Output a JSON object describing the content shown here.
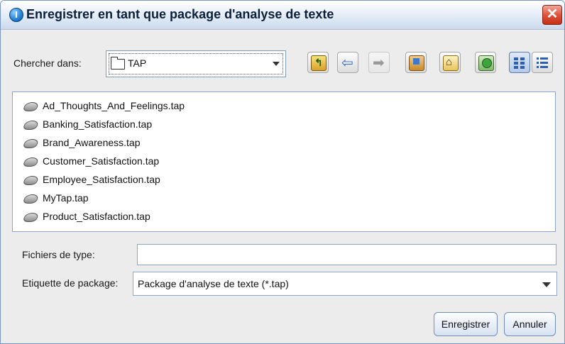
{
  "window": {
    "title": "Enregistrer en tant que package d'analyse de texte"
  },
  "look_in": {
    "label": "Chercher dans:",
    "value": "TAP"
  },
  "toolbar": {
    "icons": [
      "folder-up-icon",
      "back-icon",
      "forward-icon",
      "desktop-icon",
      "home-icon",
      "new-folder-icon",
      "list-view-icon",
      "details-view-icon"
    ]
  },
  "files": [
    "Ad_Thoughts_And_Feelings.tap",
    "Banking_Satisfaction.tap",
    "Brand_Awareness.tap",
    "Customer_Satisfaction.tap",
    "Employee_Satisfaction.tap",
    "MyTap.tap",
    "Product_Satisfaction.tap"
  ],
  "file_name": {
    "label": "Fichiers de type:",
    "value": ""
  },
  "file_type": {
    "label": "Etiquette de package:",
    "value": "Package d'analyse de texte (*.tap)"
  },
  "buttons": {
    "save": "Enregistrer",
    "cancel": "Annuler"
  },
  "colors": {
    "title_gradient_end": "#cbd9ec",
    "close": "#d9472e",
    "accent": "#2a86d8"
  }
}
